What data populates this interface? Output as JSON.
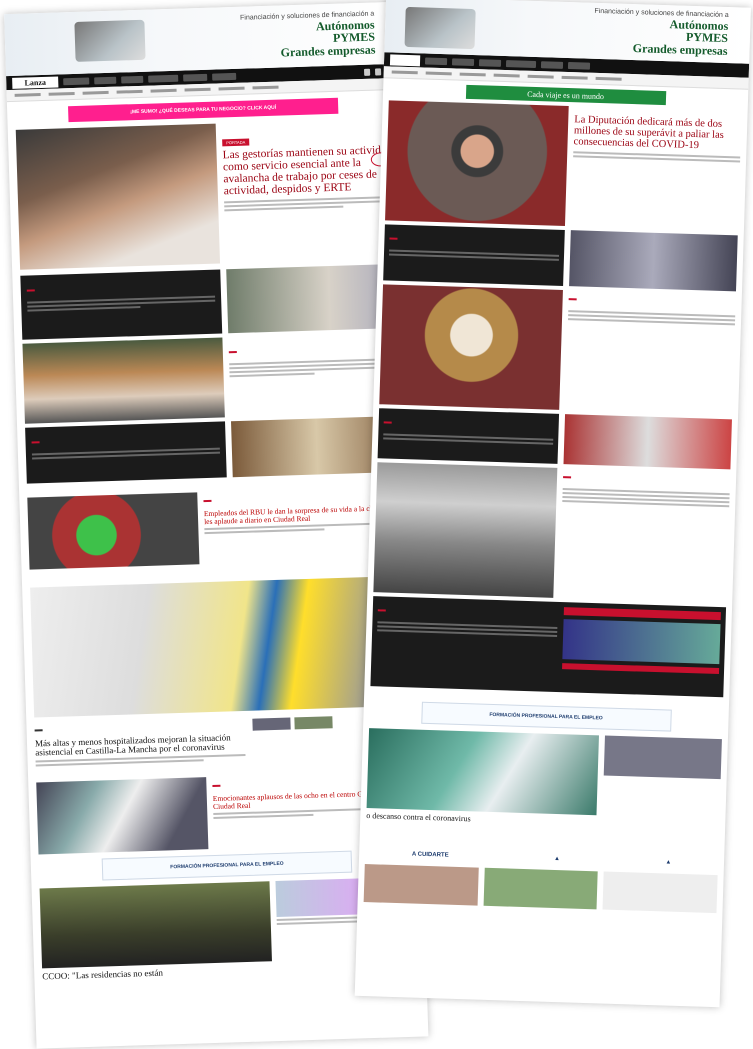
{
  "ad_top": {
    "small": "Financiación y soluciones de financiación a",
    "line1": "Autónomos",
    "line2": "PYMES",
    "line3": "Grandes empresas"
  },
  "left": {
    "logo": "Lanza",
    "pink_banner": "¡ME SUMO! ¿QUÉ DESEAS PARA TU NEGOCIO? CLICK AQUÍ",
    "lead_tag": "PORTADA",
    "lead_title": "Las gestorías mantienen su actividad como servicio esencial ante la avalancha de trabajo por ceses de actividad, despidos y ERTE",
    "story2_title": "Empleados del RBU le dan la sorpresa de su vida a la chica que les aplaude a diario en Ciudad Real",
    "story3_title": "Más altas y menos hospitalizados mejoran la situación asistencial en Castilla-La Mancha por el coronavirus",
    "story4_title": "Emocionantes aplausos de las ocho en el centro Geodiana de Ciudad Real",
    "fp_banner": "FORMACIÓN PROFESIONAL PARA EL EMPLEO",
    "bottom_title": "CCOO: \"Las residencias no están"
  },
  "right": {
    "ad_strip": "Cada viaje es un mundo",
    "lead_title": "La Diputación dedicará más de dos millones de su superávit a paliar las consecuencias del COVID-19",
    "fp_banner": "FORMACIÓN PROFESIONAL PARA EL EMPLEO",
    "bottom_story": "o descanso contra el coronavirus",
    "sponsor": "A CUIDARTE"
  },
  "colors": {
    "accent": "#c8102e",
    "headline": "#9a0010",
    "pink": "#ff1f8e",
    "ad_green": "#145b2c"
  }
}
